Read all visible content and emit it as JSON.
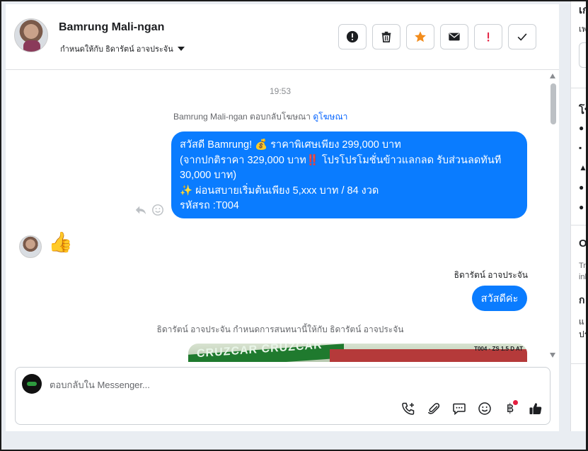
{
  "header": {
    "contact_name": "Bamrung Mali-ngan",
    "assign_label": "กำหนดให้กับ ธิดารัตน์ อาจประจัน",
    "actions": [
      "alert-circle",
      "trash",
      "star",
      "mail",
      "priority",
      "check"
    ],
    "star_color": "#f28c1c",
    "priority_color": "#e41e3f"
  },
  "thread": {
    "timestamp": "19:53",
    "system_reply": "Bamrung Mali-ngan ตอบกลับโฆษณา",
    "view_ad_link": "ดูโฆษณา",
    "outgoing_message": {
      "line1": "สวัสดี Bamrung! 💰 ราคาพิเศษเพียง 299,000 บาท",
      "line2": "(จากปกติราคา 329,000 บาท‼️ โปรโปรโมชั่นข้าวแลกลด รับส่วนลดทันที",
      "line3": "30,000 บาท)",
      "line4": "✨ ผ่อนสบายเริ่มต้นเพียง 5,xxx บาท / 84 งวด",
      "line5": "รหัสรถ :T004"
    },
    "incoming_emoji": "👍",
    "sender_name": "ธิดารัตน์ อาจประจัน",
    "short_reply": "สวัสดีค่ะ",
    "system_assign": "ธิดารัตน์ อาจประจัน กำหนดการสนทนานี้ให้กับ ธิดารัตน์ อาจประจัน",
    "image_preview": {
      "brand_text": "CRUZCAR CRUZCAR",
      "code_text": "T004 - ZS 1.5 D AT"
    },
    "bubble_color": "#0a7cff"
  },
  "composer": {
    "placeholder": "ตอบกลับใน Messenger...",
    "tools": [
      "call-plus",
      "paperclip",
      "chat",
      "emoji",
      "baht",
      "thumbs-up"
    ],
    "baht_symbol": "฿"
  },
  "right_panel": {
    "row1": "เก",
    "row2": "เพ",
    "row3": "โป",
    "row4": "O",
    "row5": "Tra",
    "row6": "inb",
    "row7": "ก",
    "row8": "แ",
    "row9": "ปร"
  }
}
